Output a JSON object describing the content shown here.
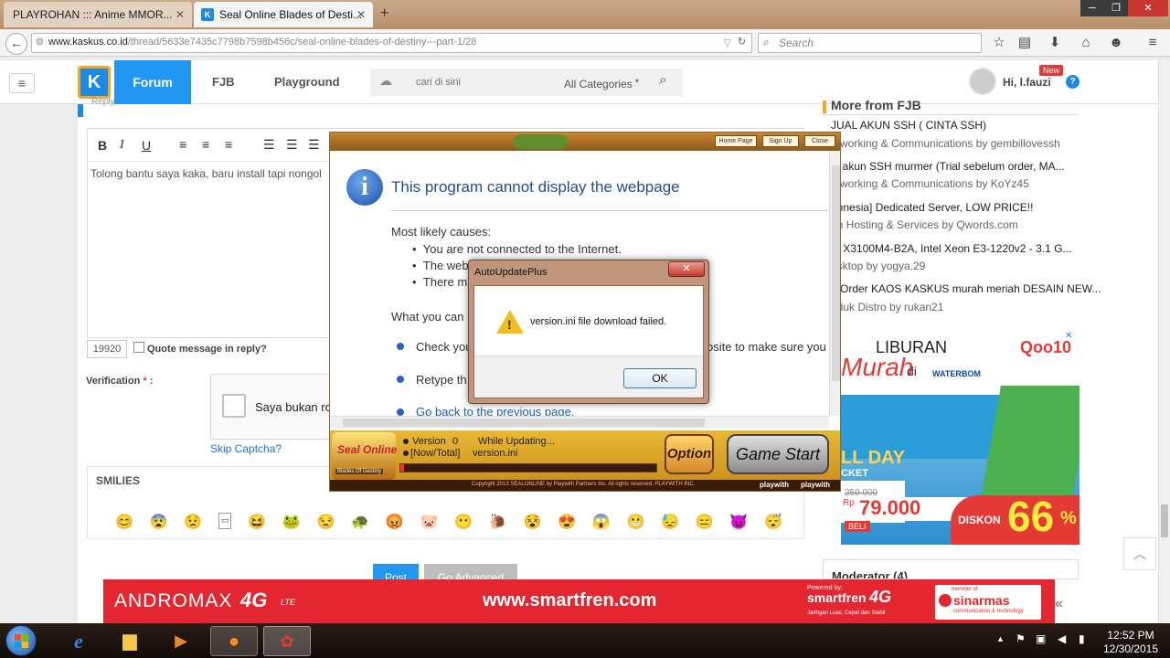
{
  "browser": {
    "tabs": [
      {
        "label": "PLAYROHAN ::: Anime MMOR...",
        "close": "✕"
      },
      {
        "label": "Seal Online Blades of Desti...",
        "close": "✕"
      }
    ],
    "new_tab": "+",
    "url_host": "www.kaskus.co.id",
    "url_path": "/thread/5633e7435c7798b7598b456c/seal-online-blades-of-destiny---part-1/28",
    "search_placeholder": "Search"
  },
  "kaskus": {
    "nav": {
      "forum": "Forum",
      "fjb": "FJB",
      "playground": "Playground"
    },
    "search_placeholder": "cari di sini",
    "category": "All Categories",
    "greeting": "Hi, l.fauzi",
    "new_badge": "New",
    "help": "?"
  },
  "editor": {
    "reply_label": "Reply",
    "bold": "B",
    "italic": "I",
    "underline": "U",
    "body_text": "Tolong bantu saya kaka, baru install tapi nongol",
    "char_count": "19920",
    "quote_label": "Quote message in reply?",
    "verification_label": "Verification",
    "required_mark": "*",
    "verification_colon": ":",
    "captcha_label": "Saya bukan ro",
    "skip_captcha": "Skip Captcha?",
    "smilies_title": "SMILIES",
    "post_button": "Post",
    "advanced_button": "Go Advanced"
  },
  "sidebar": {
    "header": "More from FJB",
    "items": [
      {
        "title": "JUAL AKUN SSH ( CINTA SSH)",
        "sub": "etworking & Communications by gembillovessh"
      },
      {
        "title": "al akun SSH murmer (Trial sebelum order, MA...",
        "sub": "etworking & Communications by KoYz45"
      },
      {
        "title": "donesia] Dedicated Server, LOW PRICE!!",
        "sub": "eb Hosting & Services by Qwords.com"
      },
      {
        "title": "M X3100M4-B2A, Intel Xeon E3-1220v2 - 3.1 G...",
        "sub": "esktop by yogya.29"
      },
      {
        "title": "e Order KAOS KASKUS murah meriah DESAIN NEW...",
        "sub": "oduk Distro by rukan21"
      }
    ],
    "moderator": "Moderator (4)",
    "ad": {
      "liburan": "LIBURAN",
      "murah": "Murah",
      "di": "di",
      "brand": "Qoo10",
      "waterbom": "WATERBOM",
      "fullday": "LL DAY",
      "ticket": "CKET",
      "old_price": "250.000",
      "rp": "Rp",
      "price": "79.000",
      "beli": "BELI",
      "diskon": "DISKON",
      "percent": "66",
      "percent_sign": "%"
    }
  },
  "game_window": {
    "top_buttons": [
      "Home Page",
      "Sign Up",
      "Close"
    ],
    "ie_error": {
      "title": "This program cannot display the webpage",
      "causes_heading": "Most likely causes:",
      "causes": [
        "You are not connected to the Internet.",
        "The web",
        "There m"
      ],
      "what_you_can": "What you can",
      "actions": [
        "Check you",
        "Retype th"
      ],
      "action_tail": "osite to make sure you",
      "back_link": "Go back to the previous page."
    },
    "status": {
      "version_label": "Version",
      "version_value": "0",
      "while_updating": "While Updating...",
      "now_total": "[Now/Total]",
      "file": "version.ini"
    },
    "option_button": "Option",
    "start_button": "Game Start",
    "copyright": "Copyright 2013 SEALONLINE by Playwith Partners Inc. All rights reserved. PLAYWITH INC.",
    "logo_text": "Seal Online",
    "logo_sub": "Blades Of Destiny",
    "playwith": [
      "playwith",
      "playwith"
    ]
  },
  "auto_dialog": {
    "title": "AutoUpdatePlus",
    "message": "version.ini file download failed.",
    "ok": "OK",
    "close": "✕"
  },
  "ad_banner": {
    "andromax": "ANDROMAX",
    "fourg": "4G",
    "lte": "LTE",
    "url": "www.smartfren.com",
    "powered": "Powered by:",
    "smartfren": "smartfren",
    "smart_4g": "4G",
    "tagline": "Jaringan Luas, Cepat dan Stabil",
    "member": "member of",
    "sinarmas": "sinarmas",
    "sinarmas_sub": "communication & technology",
    "arrow": "«"
  },
  "taskbar": {
    "time": "12:52 PM",
    "date": "12/30/2015"
  },
  "colors": {
    "kaskus_blue": "#1e88e5",
    "forum_active": "#2196f3",
    "ad_red": "#e3262f",
    "link_blue": "#1a5fb4"
  }
}
